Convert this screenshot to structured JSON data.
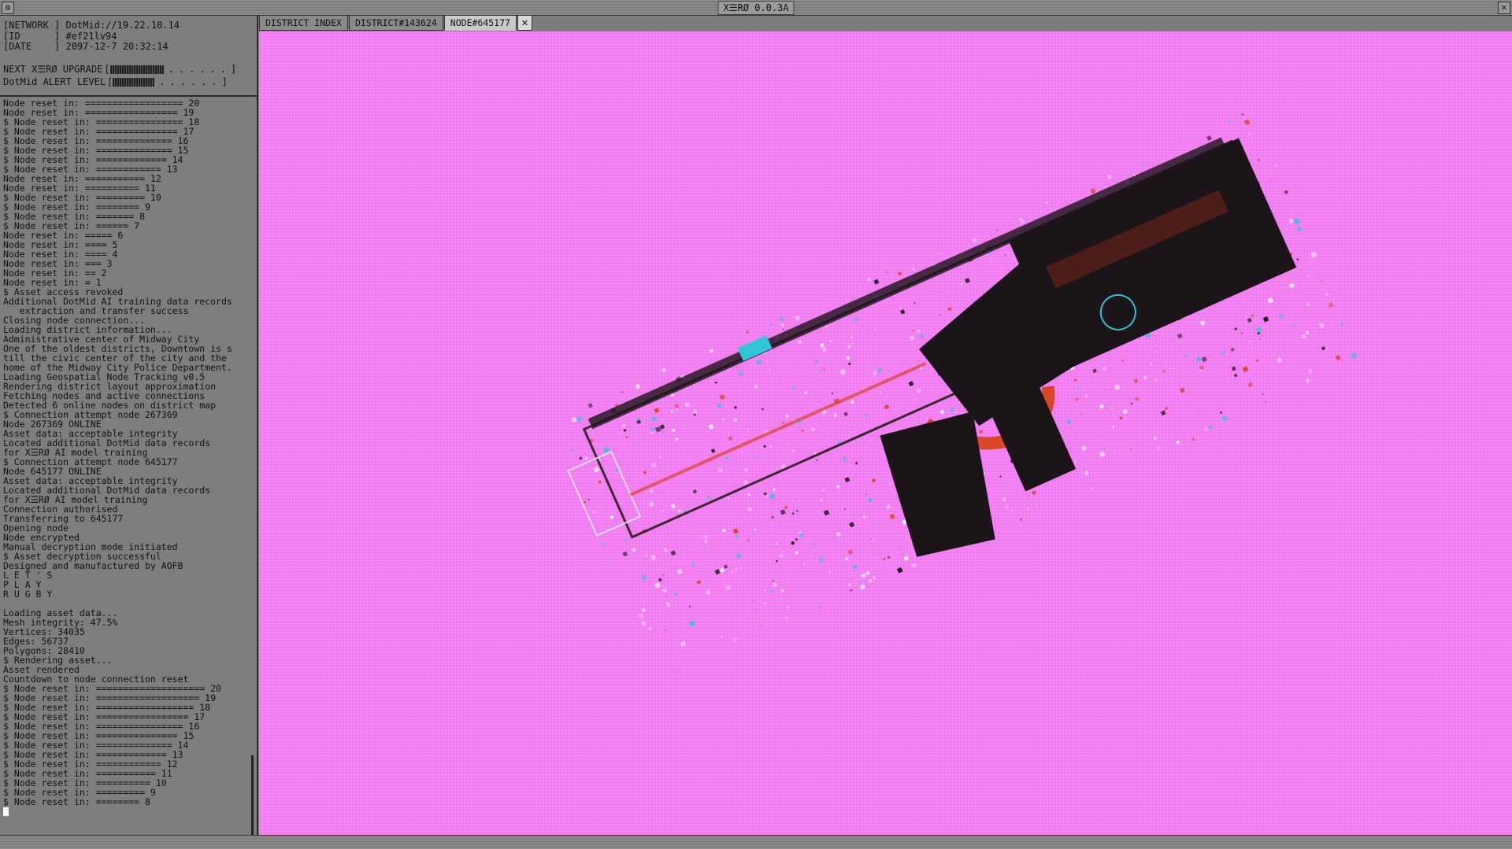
{
  "window": {
    "title": "X☰RØ 0.0.3A",
    "close_glyph": "✕",
    "menu_glyph": "⚙"
  },
  "info": {
    "network_label": "[NETWORK ]",
    "network_value": "DotMid://19.22.10.14",
    "id_label": "[ID      ]",
    "id_value": "#ef21lv94",
    "date_label": "[DATE    ]",
    "date_value": "2097-12-7 20:32:14",
    "upgrade_label": "NEXT X☰RØ UPGRADE",
    "upgrade_progress": 0.45,
    "alert_label": "DotMid ALERT LEVEL",
    "alert_progress": 0.35,
    "bar_open": "[",
    "bar_close": "]",
    "bar_dots": "......"
  },
  "log": [
    "Node reset in: ================== 20",
    "Node reset in: ================= 19",
    "$ Node reset in: ================ 18",
    "$ Node reset in: =============== 17",
    "$ Node reset in: ============== 16",
    "$ Node reset in: ============== 15",
    "$ Node reset in: ============= 14",
    "$ Node reset in: ============ 13",
    "Node reset in: =========== 12",
    "Node reset in: ========== 11",
    "$ Node reset in: ========= 10",
    "$ Node reset in: ======== 9",
    "$ Node reset in: ======= 8",
    "$ Node reset in: ====== 7",
    "Node reset in: ===== 6",
    "Node reset in: ==== 5",
    "Node reset in: ==== 4",
    "Node reset in: === 3",
    "Node reset in: == 2",
    "Node reset in: = 1",
    "$ Asset access revoked",
    "Additional DotMid AI training data records",
    "   extraction and transfer success",
    "Closing node connection...",
    "Loading district information...",
    "Administrative center of Midway City",
    "One of the oldest districts, Downtown is s",
    "till the civic center of the city and the",
    "home of the Midway City Police Department.",
    "Loading Geospatial Node Tracking v0.5",
    "Rendering district layout approximation",
    "Fetching nodes and active connections",
    "Detected 6 online nodes on district map",
    "$ Connection attempt node 267369",
    "Node 267369 ONLINE",
    "Asset data: acceptable integrity",
    "Located additional DotMid data records",
    "for X☰RØ AI model training",
    "$ Connection attempt node 645177",
    "Node 645177 ONLINE",
    "Asset data: acceptable integrity",
    "Located additional DotMid data records",
    "for X☰RØ AI model training",
    "Connection authorised",
    "Transferring to 645177",
    "Opening node",
    "Node encrypted",
    "Manual decryption mode initiated",
    "$ Asset decryption successful",
    "Designed and manufactured by AOFB",
    "L E T ' S",
    "P L A Y",
    "R U G B Y",
    "",
    "Loading asset data...",
    "Mesh integrity: 47.5%",
    "Vertices: 34035",
    "Edges: 56737",
    "Polygons: 28410",
    "$ Rendering asset...",
    "Asset rendered",
    "Countdown to node connection reset",
    "$ Node reset in: ==================== 20",
    "$ Node reset in: =================== 19",
    "$ Node reset in: ================== 18",
    "$ Node reset in: ================= 17",
    "$ Node reset in: ================ 16",
    "$ Node reset in: =============== 15",
    "$ Node reset in: ============== 14",
    "$ Node reset in: ============= 13",
    "$ Node reset in: ============ 12",
    "$ Node reset in: =========== 11",
    "$ Node reset in: ========== 10",
    "$ Node reset in: ========= 9",
    "$ Node reset in: ======== 8"
  ],
  "tabs": [
    {
      "label": "DISTRICT INDEX",
      "active": false
    },
    {
      "label": "DISTRICT#143624",
      "active": false
    },
    {
      "label": "NODE#645177",
      "active": true
    }
  ],
  "tab_close_glyph": "✕",
  "viewport": {
    "background": "#f07af0",
    "asset_body_color": "#1b1418",
    "asset_accent_color": "#d9462a",
    "asset_highlight_color": "#2fc6d8"
  }
}
